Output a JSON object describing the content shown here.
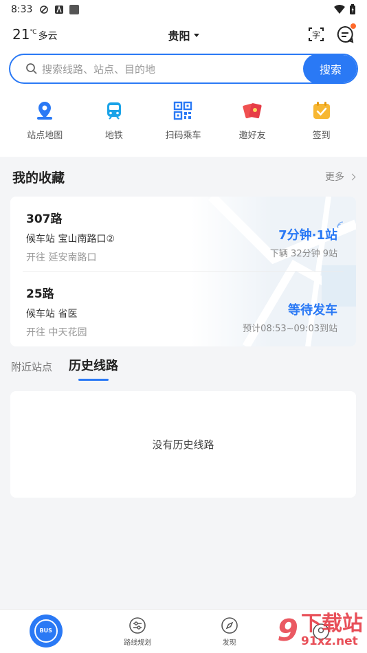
{
  "status_bar": {
    "time": "8:33"
  },
  "header": {
    "temperature": "21",
    "temp_unit": "℃",
    "condition": "多云",
    "city": "贵阳"
  },
  "search": {
    "placeholder": "搜索线路、站点、目的地",
    "button": "搜索"
  },
  "quick_actions": [
    {
      "label": "站点地图",
      "icon": "location-pin-icon"
    },
    {
      "label": "地铁",
      "icon": "metro-train-icon"
    },
    {
      "label": "扫码乘车",
      "icon": "qr-code-icon"
    },
    {
      "label": "邀好友",
      "icon": "red-envelope-icon"
    },
    {
      "label": "签到",
      "icon": "checkin-calendar-icon"
    }
  ],
  "favorites": {
    "title": "我的收藏",
    "more": "更多",
    "routes": [
      {
        "name": "307路",
        "stop": "候车站 宝山南路口②",
        "direction": "开往 延安南路口",
        "eta": "7分钟·1站",
        "info": "下辆 32分钟 9站"
      },
      {
        "name": "25路",
        "stop": "候车站 省医",
        "direction": "开往 中天花园",
        "eta": "等待发车",
        "info": "预计08:53~09:03到站"
      }
    ]
  },
  "tabs": [
    {
      "label": "附近站点",
      "active": false
    },
    {
      "label": "历史线路",
      "active": true
    }
  ],
  "history": {
    "empty_text": "没有历史线路"
  },
  "tabbar": {
    "items": [
      {
        "label": "",
        "icon": "bus-icon"
      },
      {
        "label": "路线规划",
        "icon": "route-plan-icon"
      },
      {
        "label": "发现",
        "icon": "compass-icon"
      },
      {
        "label": "",
        "icon": "profile-icon"
      }
    ],
    "bus_text": "BUS"
  },
  "watermark": {
    "number": "9",
    "title": "下载站",
    "url": "91xz.net"
  },
  "colors": {
    "accent": "#2a79f5",
    "notify_dot": "#ff6a2b",
    "watermark": "#e63c46"
  }
}
